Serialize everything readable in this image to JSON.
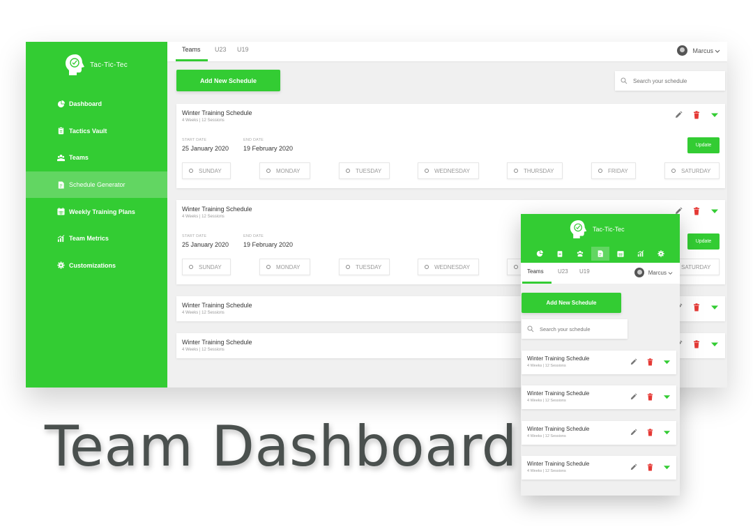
{
  "app": {
    "name": "Tac-Tic-Tec"
  },
  "colors": {
    "brand": "#33cc33",
    "active_nav": "#62d662",
    "delete": "#e53935",
    "background": "#f0f0f0"
  },
  "sidebar": {
    "items": [
      {
        "label": "Dashboard",
        "icon": "pie-chart-icon"
      },
      {
        "label": "Tactics Vault",
        "icon": "clipboard-icon"
      },
      {
        "label": "Teams",
        "icon": "group-icon"
      },
      {
        "label": "Schedule Generator",
        "icon": "schedule-doc-icon",
        "active": true
      },
      {
        "label": "Weekly Training Plans",
        "icon": "calendar-icon"
      },
      {
        "label": "Team Metrics",
        "icon": "bar-chart-icon"
      },
      {
        "label": "Customizations",
        "icon": "gear-icon"
      }
    ]
  },
  "tabs": [
    "Teams",
    "U23",
    "U19"
  ],
  "active_tab": "Teams",
  "user": {
    "name": "Marcus"
  },
  "toolbar": {
    "add_label": "Add New Schedule",
    "search_placeholder": "Search your schedule"
  },
  "schedule_labels": {
    "start": "START DATE",
    "end": "END DATE",
    "update": "Update"
  },
  "days": [
    "SUNDAY",
    "MONDAY",
    "TUESDAY",
    "WEDNESDAY",
    "THURSDAY",
    "FRIDAY",
    "SATURDAY"
  ],
  "schedules": [
    {
      "title": "Winter Training Schedule",
      "meta": "4 Weeks | 12 Sessions",
      "start_date": "25 January 2020",
      "end_date": "19 February 2020",
      "expanded": true
    },
    {
      "title": "Winter Training Schedule",
      "meta": "4 Weeks | 12 Sessions",
      "start_date": "25 January 2020",
      "end_date": "19 February 2020",
      "expanded": true
    },
    {
      "title": "Winter Training Schedule",
      "meta": "4 Weeks | 12 Sessions",
      "expanded": false
    },
    {
      "title": "Winter Training Schedule",
      "meta": "4 Weeks | 12 Sessions",
      "expanded": false
    }
  ],
  "mobile": {
    "schedules": [
      {
        "title": "Winter Training Schedule",
        "meta": "4 Weeks | 12 Sessions"
      },
      {
        "title": "Winter Training Schedule",
        "meta": "4 Weeks | 12 Sessions"
      },
      {
        "title": "Winter Training Schedule",
        "meta": "4 Weeks | 12 Sessions"
      },
      {
        "title": "Winter Training Schedule",
        "meta": "4 Weeks | 12 Sessions"
      }
    ]
  },
  "hero": {
    "title": "Team Dashboard"
  }
}
